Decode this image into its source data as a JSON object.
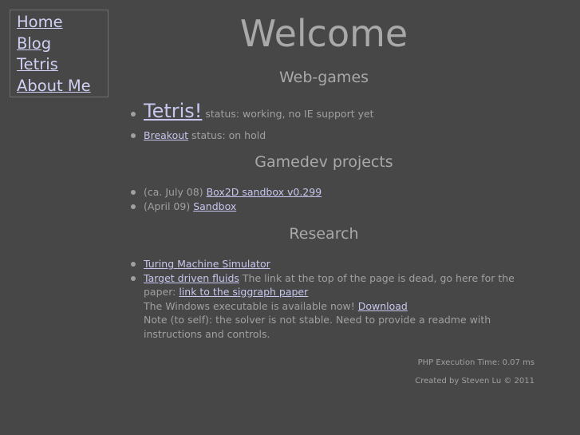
{
  "nav": {
    "items": [
      {
        "label": "Home"
      },
      {
        "label": "Blog"
      },
      {
        "label": "Tetris"
      },
      {
        "label": "About Me"
      }
    ]
  },
  "page": {
    "title": "Welcome"
  },
  "sections": {
    "webgames": {
      "heading": "Web-games",
      "items": [
        {
          "link": "Tetris!",
          "text": " status: working, no IE support yet"
        },
        {
          "link": "Breakout",
          "text": " status: on hold"
        }
      ]
    },
    "gamedev": {
      "heading": "Gamedev projects",
      "items": [
        {
          "prefix": "(ca. July 08) ",
          "link": "Box2D sandbox v0.299"
        },
        {
          "prefix": "(April 09) ",
          "link": "Sandbox"
        }
      ]
    },
    "research": {
      "heading": "Research",
      "items": [
        {
          "link": "Turing Machine Simulator"
        },
        {
          "link": "Target driven fluids",
          "text": " The link at the top of the page is dead, go here for the paper: ",
          "paper_link": "link to the siggraph paper",
          "line2": "The Windows executable is available now! ",
          "download_link": "Download",
          "note": "Note (to self): the solver is not stable. Need to provide a readme with instructions and controls."
        }
      ]
    }
  },
  "footer": {
    "exec_time": "PHP Execution Time: 0.07 ms",
    "credit": "Created by Steven Lu © 2011"
  }
}
